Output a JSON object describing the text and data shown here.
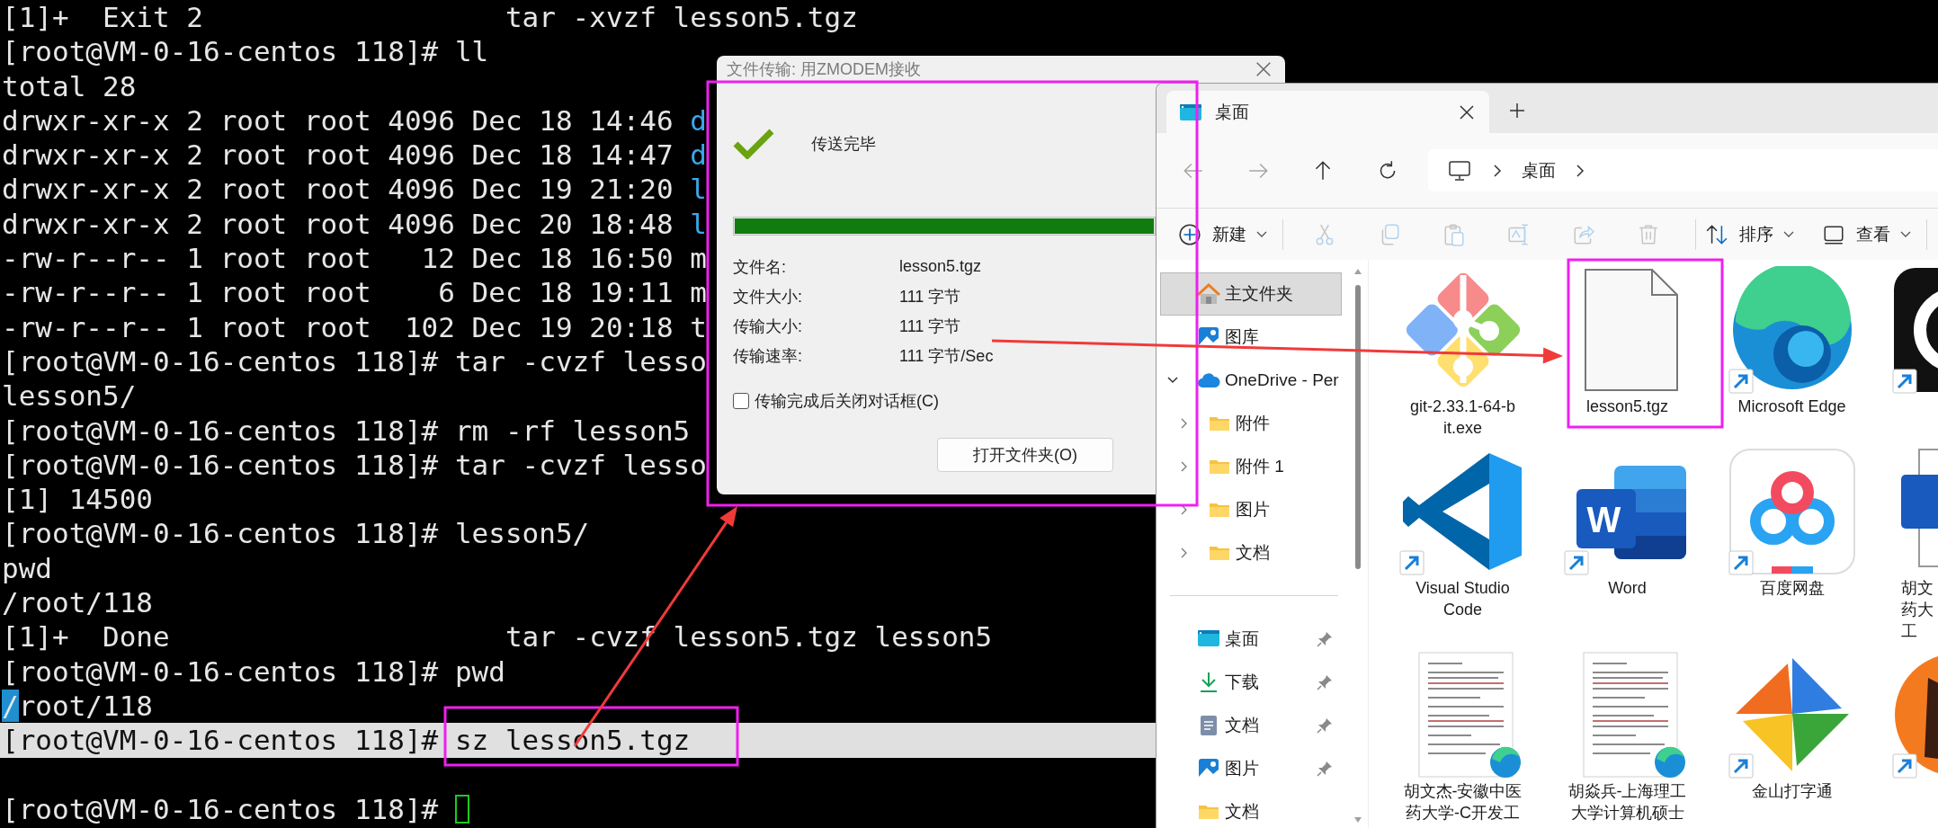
{
  "terminal": {
    "lines": [
      {
        "text": "[1]+  Exit 2                  tar -xvzf lesson5.tgz"
      },
      {
        "text": "[root@VM-0-16-centos 118]# ll"
      },
      {
        "text": "total 28"
      },
      {
        "text": "drwxr-xr-x 2 root root 4096 Dec 18 14:46 ",
        "tail": {
          "text": "d",
          "color": "#3aa8ec"
        }
      },
      {
        "text": "drwxr-xr-x 2 root root 4096 Dec 18 14:47 ",
        "tail": {
          "text": "d",
          "color": "#3aa8ec"
        }
      },
      {
        "text": "drwxr-xr-x 2 root root 4096 Dec 19 21:20 ",
        "tail": {
          "text": "l",
          "color": "#3aa8ec"
        }
      },
      {
        "text": "drwxr-xr-x 2 root root 4096 Dec 20 18:48 ",
        "tail": {
          "text": "l",
          "color": "#3aa8ec"
        }
      },
      {
        "text": "-rw-r--r-- 1 root root   12 Dec 18 16:50 ",
        "tail": {
          "text": "m",
          "color": "#e6e6e6"
        }
      },
      {
        "text": "-rw-r--r-- 1 root root    6 Dec 18 19:11 ",
        "tail": {
          "text": "m",
          "color": "#e6e6e6"
        }
      },
      {
        "text": "-rw-r--r-- 1 root root  102 Dec 19 20:18 ",
        "tail": {
          "text": "t",
          "color": "#e6e6e6"
        }
      },
      {
        "text": "[root@VM-0-16-centos 118]# tar -cvzf lesso"
      },
      {
        "text": "lesson5/"
      },
      {
        "text": "[root@VM-0-16-centos 118]# rm -rf lesson5"
      },
      {
        "text": "[root@VM-0-16-centos 118]# tar -cvzf lesso"
      },
      {
        "text": "[1] 14500"
      },
      {
        "text": "[root@VM-0-16-centos 118]# lesson5/"
      },
      {
        "text": "pwd"
      },
      {
        "text": "/root/118"
      },
      {
        "text": "[1]+  Done                    tar -cvzf lesson5.tgz lesson5"
      },
      {
        "text": "[root@VM-0-16-centos 118]# pwd"
      },
      {
        "text": "/root/118",
        "first_char_marked": true
      },
      {
        "text": "[root@VM-0-16-centos 118]# sz lesson5.tgz",
        "highlighted": true
      },
      {
        "kind": "blank"
      },
      {
        "text": "[root@VM-0-16-centos 118]# ",
        "cursor": true
      }
    ]
  },
  "dialog": {
    "title": "文件传输: 用ZMODEM接收",
    "status": "传送完毕",
    "progress": {
      "level": 1
    },
    "fields": [
      {
        "label": "文件名:",
        "value": "lesson5.tgz"
      },
      {
        "label": "文件大小:",
        "value": "111 字节"
      },
      {
        "label": "传输大小:",
        "value": "111 字节"
      },
      {
        "label": "传输速率:",
        "value": "111 字节/Sec"
      }
    ],
    "checkbox": {
      "label": "传输完成后关闭对话框(C)",
      "checked": false
    },
    "buttons": [
      "打开文件夹(O)"
    ]
  },
  "explorer": {
    "tabs": [
      {
        "title": "桌面",
        "selected": true
      }
    ],
    "nav": [
      {
        "kind": "back",
        "disabled": true
      },
      {
        "kind": "forward",
        "disabled": true
      },
      {
        "kind": "up",
        "disabled": false
      },
      {
        "kind": "refresh",
        "disabled": false
      }
    ],
    "address": [
      "桌面"
    ],
    "toolbar": [
      {
        "kind": "new",
        "label": "新建",
        "disabled": false
      },
      {
        "kind": "cut",
        "disabled": true
      },
      {
        "kind": "copy",
        "disabled": true
      },
      {
        "kind": "paste",
        "disabled": true
      },
      {
        "kind": "rename",
        "disabled": true
      },
      {
        "kind": "share",
        "disabled": true
      },
      {
        "kind": "delete",
        "disabled": true
      },
      {
        "kind": "sort",
        "label": "排序",
        "disabled": false
      },
      {
        "kind": "view",
        "label": "查看",
        "disabled": false
      }
    ],
    "sidebar": [
      {
        "label": "主文件夹",
        "kind": "home",
        "selected": true
      },
      {
        "label": "图库",
        "kind": "gallery",
        "selected": false
      },
      {
        "label": "OneDrive - Per",
        "kind": "cloud",
        "selected": false,
        "expanded": true,
        "children": [
          {
            "label": "附件",
            "kind": "folder",
            "selected": false,
            "expanded": false
          },
          {
            "label": "附件 1",
            "kind": "folder",
            "selected": false,
            "expanded": false
          },
          {
            "label": "图片",
            "kind": "folder",
            "selected": false,
            "expanded": false
          },
          {
            "label": "文档",
            "kind": "folder",
            "selected": false,
            "expanded": false
          }
        ]
      }
    ],
    "pinned": [
      {
        "label": "桌面",
        "kind": "desktop",
        "pinned": true
      },
      {
        "label": "下载",
        "kind": "download",
        "pinned": true
      },
      {
        "label": "文档",
        "kind": "document",
        "pinned": true
      },
      {
        "label": "图片",
        "kind": "picture",
        "pinned": true
      },
      {
        "label": "文档",
        "kind": "folder",
        "pinned": false
      }
    ],
    "items": [
      {
        "kind": "git",
        "label": [
          "git-2.33.1-64-b",
          "it.exe"
        ],
        "shortcut": false
      },
      {
        "kind": "file",
        "label": [
          "lesson5.tgz"
        ],
        "shortcut": false
      },
      {
        "kind": "edge",
        "label": [
          "Microsoft Edge"
        ],
        "shortcut": true
      },
      {
        "kind": "app",
        "shortcut": true
      },
      {
        "kind": "vscode",
        "label": [
          "Visual Studio",
          "Code"
        ],
        "shortcut": true
      },
      {
        "kind": "word",
        "glyph": "W",
        "label": [
          "Word"
        ],
        "shortcut": true
      },
      {
        "kind": "baidu",
        "label": [
          "百度网盘"
        ],
        "shortcut": true
      },
      {
        "kind": "worddoc",
        "label": [
          "胡文",
          "药大",
          "工"
        ],
        "shortcut": false
      },
      {
        "kind": "pdfdoc",
        "label": [
          "胡文杰-安徽中医",
          "药大学-C开发工"
        ],
        "shortcut": false
      },
      {
        "kind": "pdfdoc",
        "label": [
          "胡焱兵-上海理工",
          "大学计算机硕士"
        ],
        "shortcut": false
      },
      {
        "kind": "kingsoft",
        "label": [
          "金山打字通"
        ],
        "shortcut": true
      },
      {
        "kind": "orange",
        "shortcut": true
      }
    ]
  },
  "annotations": [
    {
      "kind": "frame"
    },
    {
      "kind": "frame"
    },
    {
      "kind": "frame"
    },
    {
      "kind": "arrow"
    },
    {
      "kind": "arrow"
    }
  ]
}
